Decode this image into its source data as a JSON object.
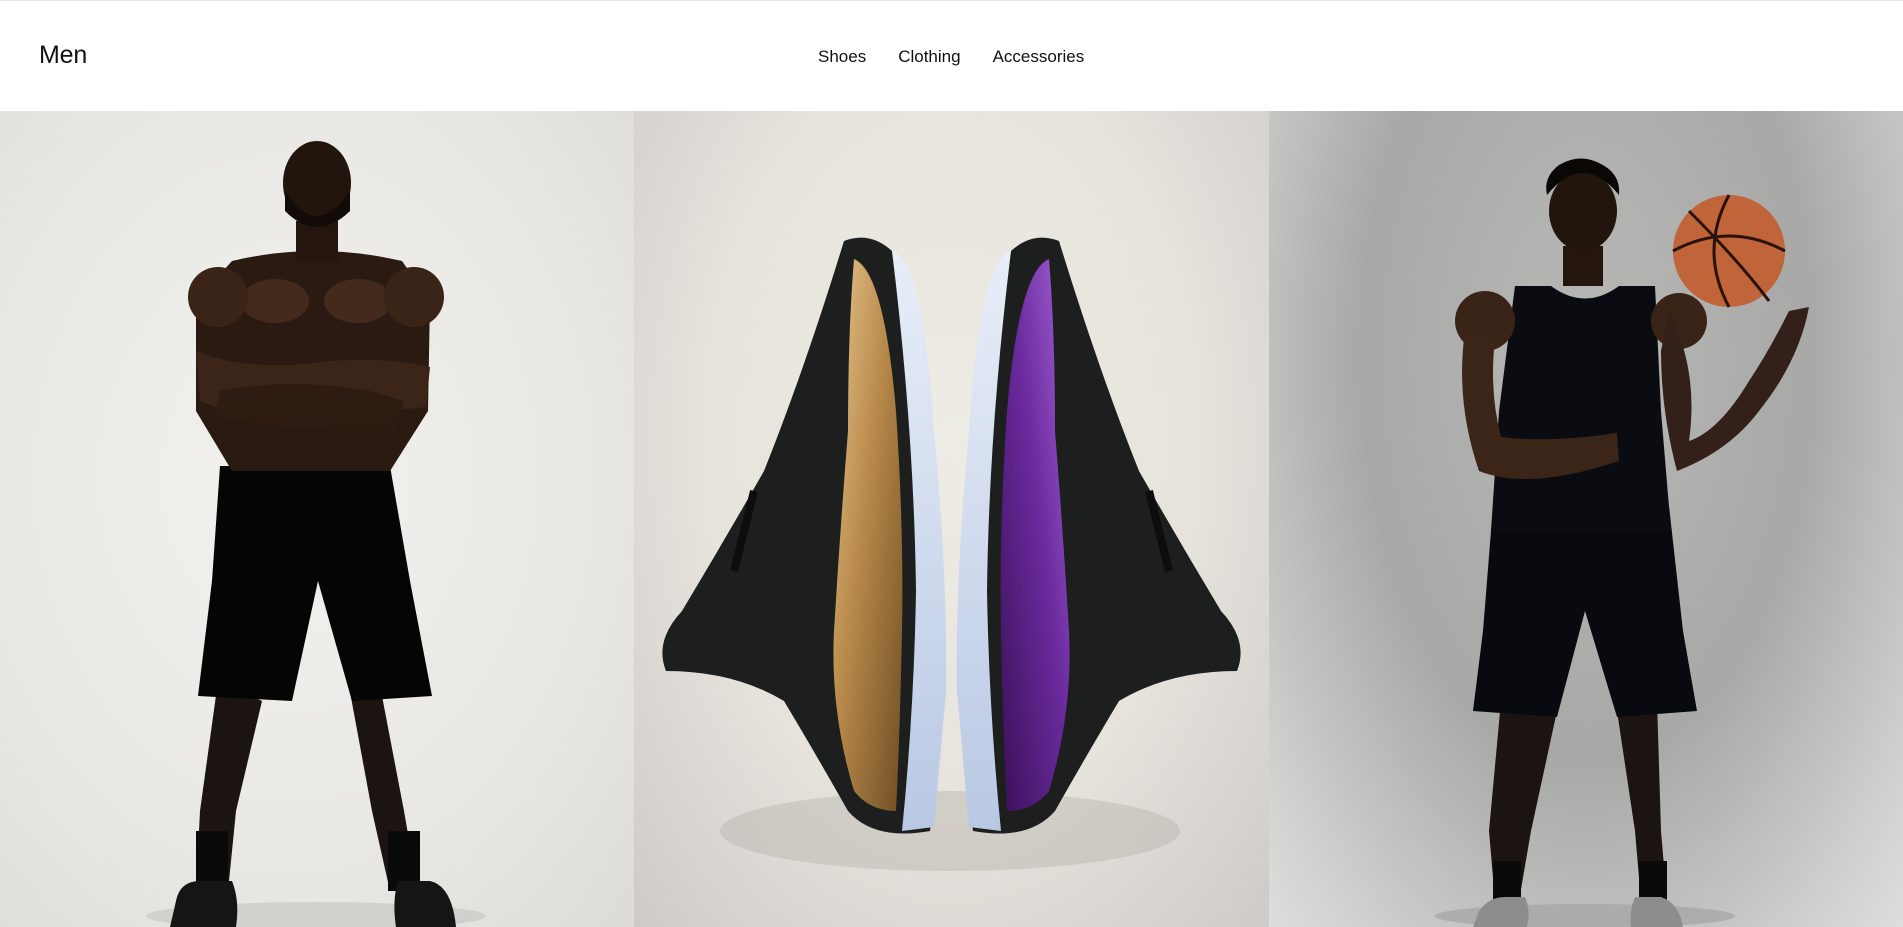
{
  "subnav": {
    "title": "Men",
    "links": [
      {
        "label": "Shoes"
      },
      {
        "label": "Clothing"
      },
      {
        "label": "Accessories"
      }
    ]
  },
  "hero": {
    "panels": [
      {
        "subject": "athlete-arms-crossed"
      },
      {
        "subject": "sneaker-pair-gold-purple"
      },
      {
        "subject": "athlete-holding-basketball"
      }
    ]
  },
  "colors": {
    "text": "#111111",
    "background": "#ffffff",
    "shoe_gold": "#b8894a",
    "shoe_purple": "#6b2a9e",
    "basketball": "#c0653a"
  }
}
